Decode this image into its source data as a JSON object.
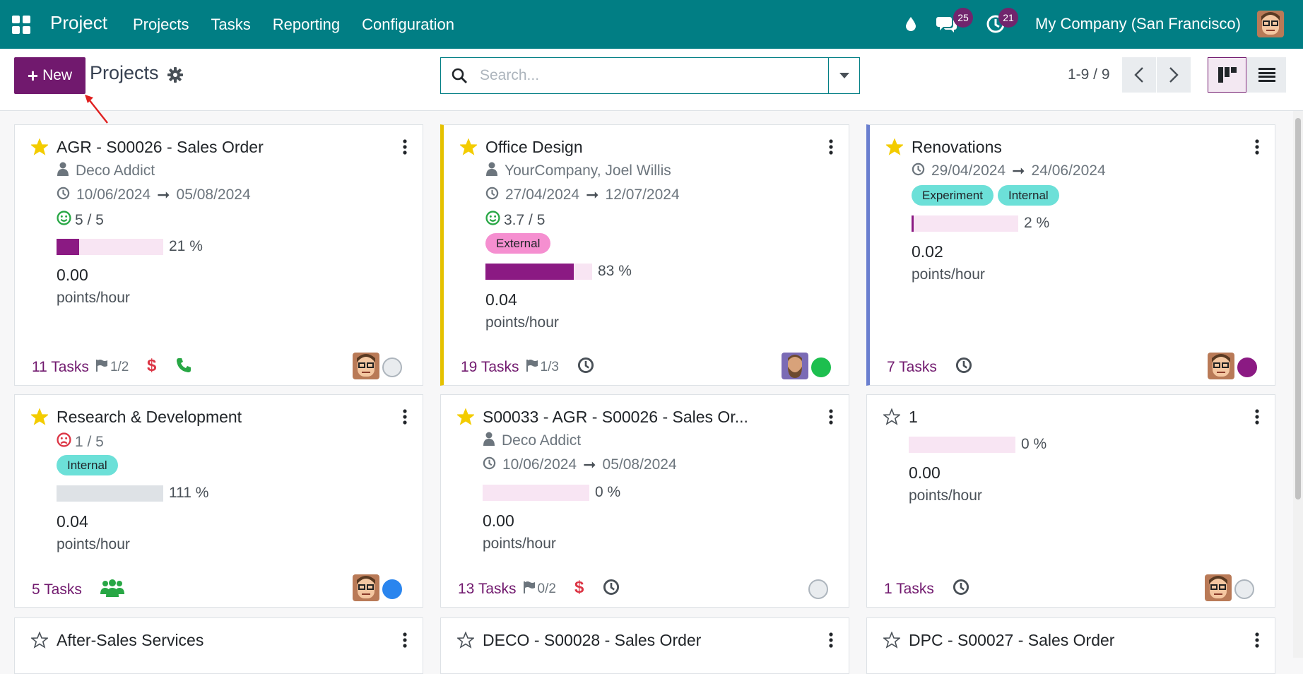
{
  "navbar": {
    "app_name": "Project",
    "menu": [
      "Projects",
      "Tasks",
      "Reporting",
      "Configuration"
    ],
    "messages_count": "25",
    "activities_count": "21",
    "company": "My Company (San Francisco)",
    "bg_color": "#017e84"
  },
  "control_panel": {
    "new_label": "New",
    "title": "Projects",
    "search_placeholder": "Search...",
    "pager": "1-9 / 9",
    "accent_color": "#71196e"
  },
  "cards": [
    {
      "title": "AGR - S00026 - Sales Order",
      "favorite": true,
      "customer": "Deco Addict",
      "date_start": "10/06/2024",
      "date_end": "05/08/2024",
      "rating": "5 / 5",
      "rating_mood": "happy",
      "tags": [],
      "progress": 21,
      "progress_label": "21 %",
      "score": "0.00",
      "unit": "points/hour",
      "tasks": "11 Tasks",
      "milestones": "1/2",
      "icons": [
        "dollar-icon",
        "phone-icon"
      ],
      "status": "grey"
    },
    {
      "title": "Office Design",
      "favorite": true,
      "customer": "YourCompany, Joel Willis",
      "date_start": "27/04/2024",
      "date_end": "12/07/2024",
      "rating": "3.7 / 5",
      "rating_mood": "happy",
      "tags": [
        {
          "label": "External",
          "color": "#f58fd0"
        }
      ],
      "progress": 83,
      "progress_label": "83 %",
      "score": "0.04",
      "unit": "points/hour",
      "tasks": "19 Tasks",
      "milestones": "1/3",
      "icons": [
        "clock-icon"
      ],
      "status": "green"
    },
    {
      "title": "Renovations",
      "favorite": true,
      "date_start": "29/04/2024",
      "date_end": "24/06/2024",
      "tags": [
        {
          "label": "Experiment",
          "color": "#6ce0d8"
        },
        {
          "label": "Internal",
          "color": "#6ce0d8"
        }
      ],
      "progress": 2,
      "progress_label": "2 %",
      "score": "0.02",
      "unit": "points/hour",
      "tasks": "7 Tasks",
      "icons": [
        "clock-icon"
      ],
      "status": "purple"
    },
    {
      "title": "Research & Development",
      "favorite": true,
      "rating": "1 / 5",
      "rating_mood": "sad",
      "tags": [
        {
          "label": "Internal",
          "color": "#6ce0d8"
        }
      ],
      "progress": 111,
      "progress_label": "111 %",
      "score": "0.04",
      "unit": "points/hour",
      "tasks": "5 Tasks",
      "icons": [
        "users-icon"
      ],
      "status": "blue"
    },
    {
      "title": "S00033 - AGR - S00026 - Sales Or...",
      "favorite": true,
      "customer": "Deco Addict",
      "date_start": "10/06/2024",
      "date_end": "05/08/2024",
      "tags": [],
      "progress": 0,
      "progress_label": "0 %",
      "score": "0.00",
      "unit": "points/hour",
      "tasks": "13 Tasks",
      "milestones": "0/2",
      "icons": [
        "dollar-icon",
        "clock-icon"
      ],
      "status": "grey"
    },
    {
      "title": "1",
      "favorite": false,
      "tags": [],
      "progress": 0,
      "progress_label": "0 %",
      "score": "0.00",
      "unit": "points/hour",
      "tasks": "1 Tasks",
      "icons": [
        "clock-icon"
      ],
      "status": "grey"
    },
    {
      "title": "After-Sales Services",
      "favorite": false
    },
    {
      "title": "DECO - S00028 - Sales Order",
      "favorite": false
    },
    {
      "title": "DPC - S00027 - Sales Order",
      "favorite": false
    }
  ]
}
